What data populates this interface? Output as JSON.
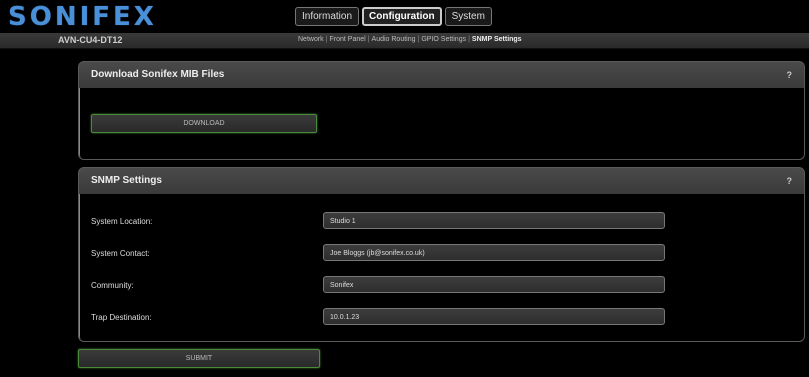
{
  "header": {
    "logo": "SONIFEX",
    "tabs": [
      {
        "label": "Information"
      },
      {
        "label": "Configuration"
      },
      {
        "label": "System"
      }
    ],
    "active_tab": "Configuration",
    "device_name": "AVN-CU4-DT12"
  },
  "subnav": {
    "items": [
      "Network",
      "Front Panel",
      "Audio Routing",
      "GPIO Settings",
      "SNMP Settings"
    ],
    "current": "SNMP Settings"
  },
  "download_panel": {
    "title": "Download Sonifex MIB Files",
    "help": "?",
    "button_label": "DOWNLOAD"
  },
  "snmp_panel": {
    "title": "SNMP Settings",
    "help": "?",
    "fields": [
      {
        "label": "System Location:",
        "value": "Studio 1"
      },
      {
        "label": "System Contact:",
        "value": "Joe Bloggs (jb@sonifex.co.uk)"
      },
      {
        "label": "Community:",
        "value": "Sonifex"
      },
      {
        "label": "Trap Destination:",
        "value": "10.0.1.23"
      }
    ]
  },
  "submit_label": "SUBMIT",
  "colors": {
    "logo": "#4a90d9",
    "button_border": "#4a8a3a"
  }
}
